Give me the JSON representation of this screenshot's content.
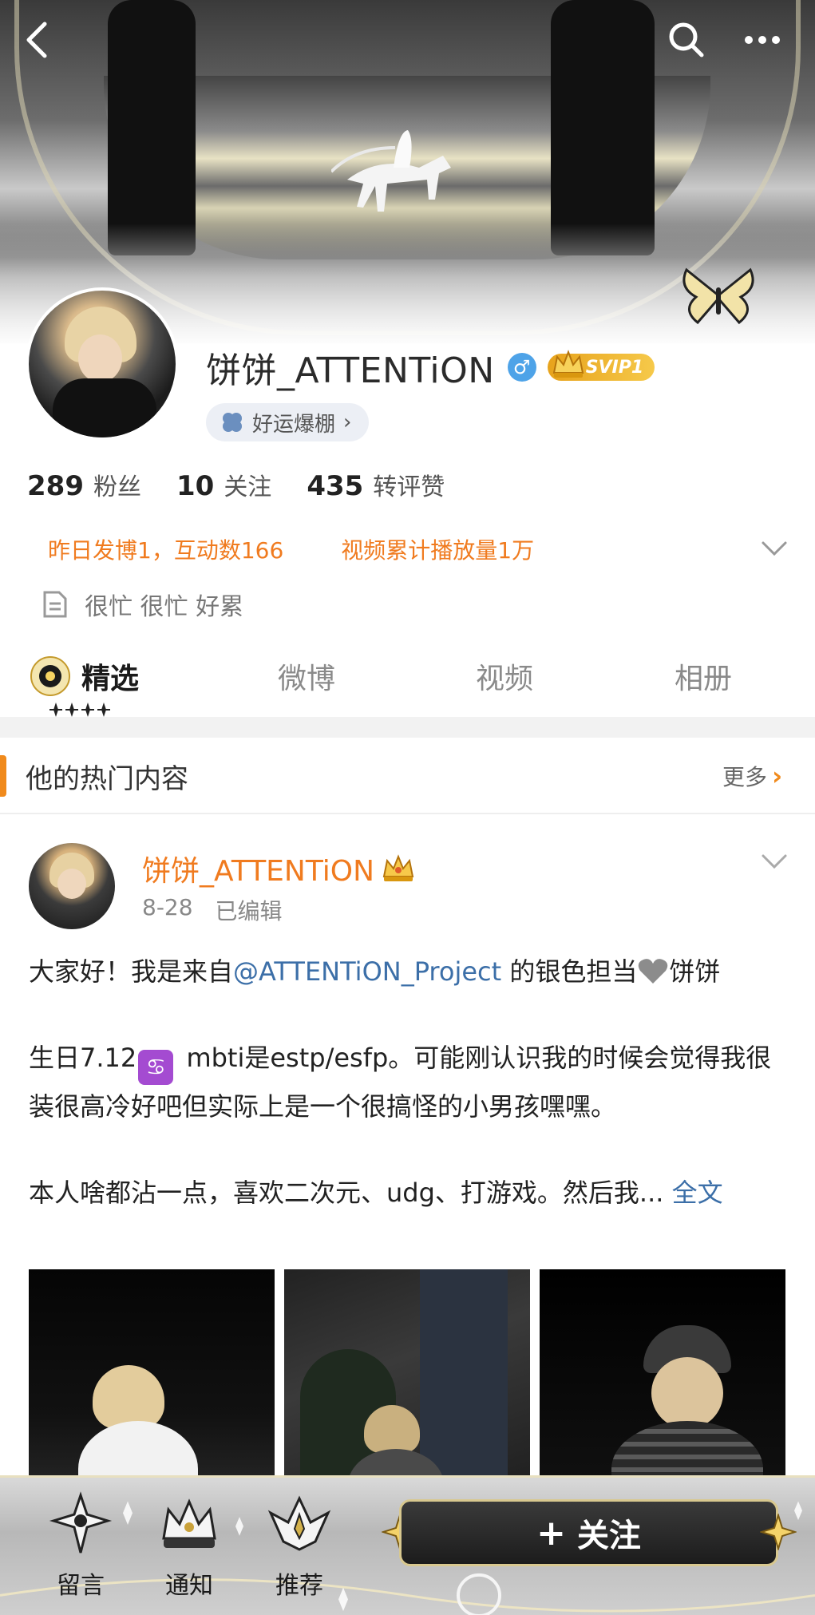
{
  "profile": {
    "name": "饼饼_ATTENTiON",
    "gender_symbol": "♂",
    "svip": "SVIP1",
    "luck_tag": "好运爆棚",
    "luck_tag_chevron": "›",
    "stats": [
      {
        "num": "289",
        "label": "粉丝"
      },
      {
        "num": "10",
        "label": "关注"
      },
      {
        "num": "435",
        "label": "转评赞"
      }
    ],
    "highlights": [
      "昨日发博1，互动数166",
      "视频累计播放量1万"
    ],
    "bio": "很忙 很忙 好累"
  },
  "tabs": [
    {
      "label": "精选",
      "active": true
    },
    {
      "label": "微博",
      "active": false
    },
    {
      "label": "视频",
      "active": false
    },
    {
      "label": "相册",
      "active": false
    }
  ],
  "hot": {
    "title": "他的热门内容",
    "more": "更多",
    "more_chevron": "›"
  },
  "post": {
    "author": "饼饼_ATTENTiON",
    "date": "8-28",
    "edited": "已编辑",
    "line1_a": "大家好！我是来自",
    "mention": "@ATTENTiON_Project",
    "line1_b": " 的银色担当",
    "line1_c": "饼饼",
    "line2_a": "生日7.12",
    "cancer_glyph": "♋",
    "line2_b": " mbti是estp/esfp。可能刚认识我的时候会觉得我很装很高冷好吧但实际上是一个很搞怪的小男孩嘿嘿。",
    "line3": "本人啥都沾一点，喜欢二次元、udg、打游戏。然后我...",
    "fulltext": "全文"
  },
  "bottom_bar": {
    "items": [
      {
        "label": "留言",
        "icon": "cross-ornament-icon"
      },
      {
        "label": "通知",
        "icon": "crown-ornament-icon"
      },
      {
        "label": "推荐",
        "icon": "wing-ornament-icon"
      }
    ],
    "follow": "关注",
    "follow_plus": "+"
  },
  "colors": {
    "accent_orange": "#f07b1f",
    "link_blue": "#3c6fa8",
    "svip_gold": "#e7a31c",
    "gender_blue": "#4ea3e8"
  }
}
